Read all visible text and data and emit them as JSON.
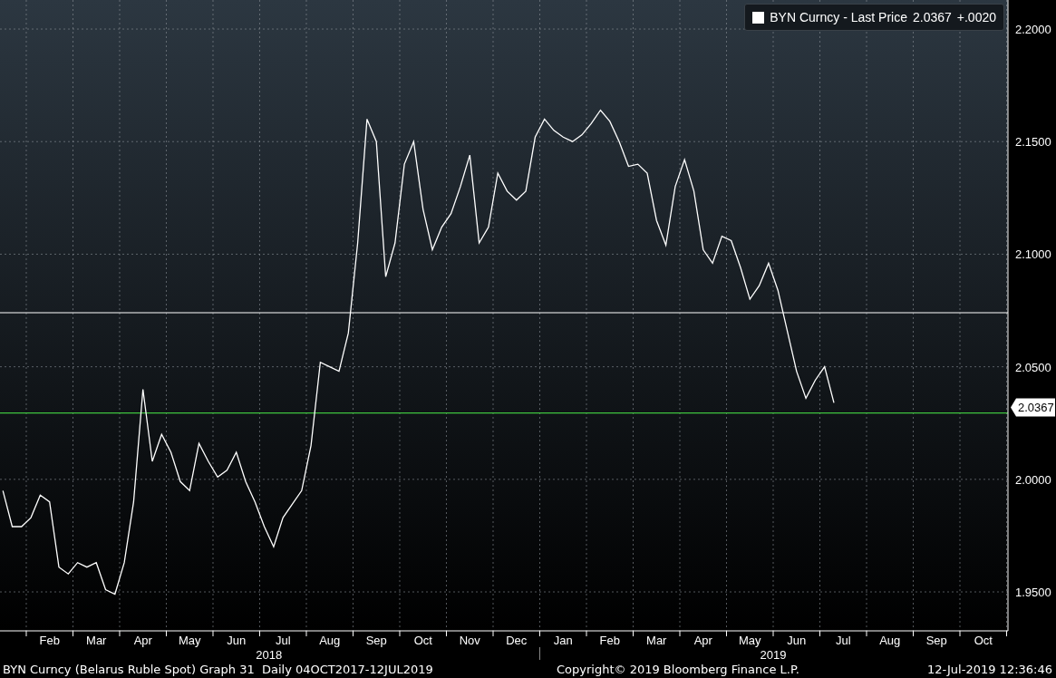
{
  "legend": {
    "value": "2.0367",
    "change": "+.0020"
  },
  "last_price_tag": {
    "text": "2.0367"
  },
  "chart_data": {
    "type": "line",
    "grid": true,
    "ylim": [
      1.9327,
      2.2129
    ],
    "categories": [
      null,
      null,
      null,
      null,
      null,
      "Feb",
      null,
      null,
      null,
      null,
      "Mar",
      null,
      null,
      null,
      null,
      "Apr",
      null,
      null,
      null,
      null,
      "May",
      null,
      null,
      null,
      null,
      "Jun",
      null,
      null,
      null,
      null,
      "Jul",
      null,
      null,
      null,
      null,
      "Aug",
      null,
      null,
      null,
      null,
      "Sep",
      null,
      null,
      null,
      null,
      "Oct",
      null,
      null,
      null,
      null,
      "Nov",
      null,
      null,
      null,
      null,
      "Dec",
      null,
      null,
      null,
      null,
      "Jan",
      null,
      null,
      null,
      null,
      "Feb",
      null,
      null,
      null,
      null,
      "Mar",
      null,
      null,
      null,
      null,
      "Apr",
      null,
      null,
      null,
      null,
      "May",
      null,
      null,
      null,
      null,
      "Jun",
      null,
      null,
      null,
      null,
      "Jul",
      null,
      null,
      null,
      null,
      "Aug",
      null,
      null,
      null,
      null,
      "Sep",
      null,
      null,
      null,
      null,
      "Oct",
      null,
      null
    ],
    "series": [
      {
        "name": "BYN Curncy - Last Price",
        "color": "#ffffff",
        "values": [
          1.995,
          1.979,
          1.979,
          1.983,
          1.993,
          1.99,
          1.961,
          1.958,
          1.963,
          1.961,
          1.963,
          1.951,
          1.949,
          1.963,
          1.99,
          2.04,
          2.008,
          2.02,
          2.012,
          1.999,
          1.995,
          2.016,
          2.008,
          2.001,
          2.004,
          2.012,
          1.999,
          1.99,
          1.979,
          1.97,
          1.983,
          1.989,
          1.995,
          2.015,
          2.052,
          2.05,
          2.048,
          2.065,
          2.105,
          2.16,
          2.15,
          2.09,
          2.105,
          2.14,
          2.15,
          2.12,
          2.102,
          2.112,
          2.118,
          2.13,
          2.144,
          2.105,
          2.112,
          2.136,
          2.128,
          2.124,
          2.128,
          2.152,
          2.16,
          2.155,
          2.152,
          2.15,
          2.153,
          2.158,
          2.164,
          2.159,
          2.15,
          2.139,
          2.14,
          2.136,
          2.115,
          2.104,
          2.13,
          2.142,
          2.128,
          2.102,
          2.096,
          2.108,
          2.106,
          2.094,
          2.08,
          2.086,
          2.096,
          2.084,
          2.066,
          2.048,
          2.036,
          2.044,
          2.05,
          2.034,
          null,
          null,
          null,
          null,
          null,
          null,
          null,
          null,
          null,
          null,
          null,
          null,
          null,
          null,
          null,
          null,
          null,
          null
        ]
      }
    ],
    "yticks": [
      {
        "value": 1.95,
        "label": "1.9500"
      },
      {
        "value": 2.0,
        "label": "2.0000"
      },
      {
        "value": 2.05,
        "label": "2.0500"
      },
      {
        "value": 2.1,
        "label": "2.1000"
      },
      {
        "value": 2.15,
        "label": "2.1500"
      },
      {
        "value": 2.2,
        "label": "2.2000"
      }
    ],
    "ref_lines": [
      {
        "axis": "y",
        "value": 2.074,
        "color": "#ffffff"
      },
      {
        "axis": "y",
        "value": 2.0295,
        "color": "#3ec43e"
      }
    ],
    "annotations": [
      "2018",
      "2019"
    ]
  },
  "footer": {
    "description": "BYN Curncy (Belarus Ruble Spot) Graph 31  Daily 04OCT2017-12JUL2019",
    "copyright": "Copyright© 2019 Bloomberg Finance L.P.",
    "timestamp": "12-Jul-2019 12:36:46"
  }
}
